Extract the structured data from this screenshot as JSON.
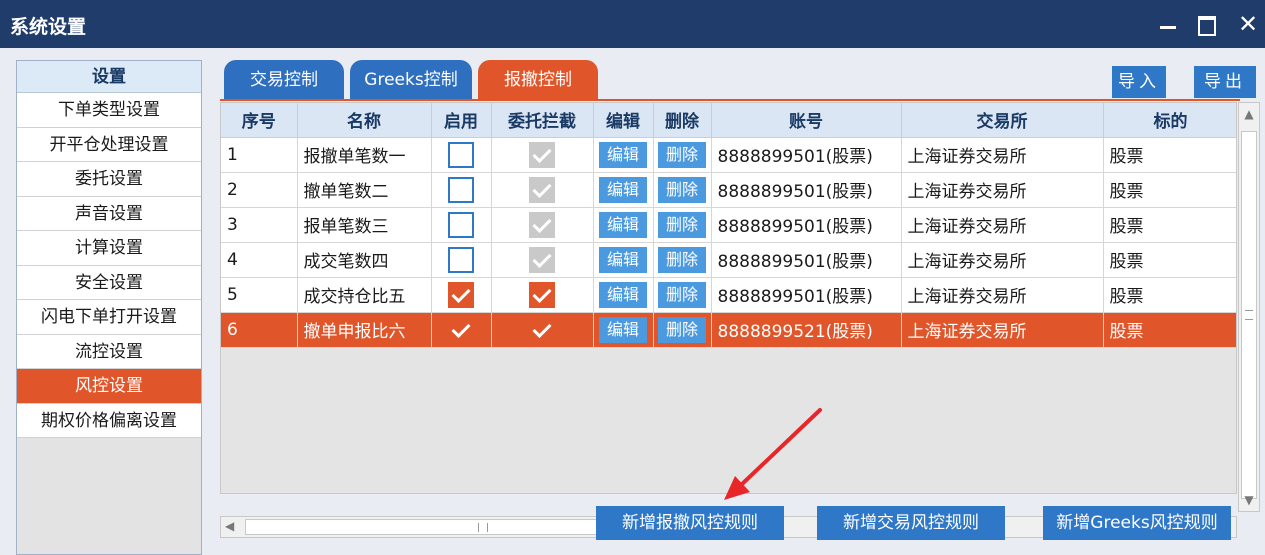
{
  "window": {
    "title": "系统设置"
  },
  "sidebar": {
    "header": "设置",
    "items": [
      "下单类型设置",
      "开平仓处理设置",
      "委托设置",
      "声音设置",
      "计算设置",
      "安全设置",
      "闪电下单打开设置",
      "流控设置",
      "风控设置",
      "期权价格偏离设置"
    ],
    "active_index": 8
  },
  "tabs": [
    "交易控制",
    "Greeks控制",
    "报撤控制"
  ],
  "active_tab": 2,
  "toolbar": {
    "import_label": "导入",
    "export_label": "导出"
  },
  "table": {
    "columns": [
      "序号",
      "名称",
      "启用",
      "委托拦截",
      "编辑",
      "删除",
      "账号",
      "交易所",
      "标的"
    ],
    "edit_label": "编辑",
    "delete_label": "删除",
    "rows": [
      {
        "no": "1",
        "name": "报撤单笔数一",
        "enabled": false,
        "intercept": true,
        "account": "8888899501(股票)",
        "exchange": "上海证券交易所",
        "target": "股票"
      },
      {
        "no": "2",
        "name": "撤单笔数二",
        "enabled": false,
        "intercept": true,
        "account": "8888899501(股票)",
        "exchange": "上海证券交易所",
        "target": "股票"
      },
      {
        "no": "3",
        "name": "报单笔数三",
        "enabled": false,
        "intercept": true,
        "account": "8888899501(股票)",
        "exchange": "上海证券交易所",
        "target": "股票"
      },
      {
        "no": "4",
        "name": "成交笔数四",
        "enabled": false,
        "intercept": true,
        "account": "8888899501(股票)",
        "exchange": "上海证券交易所",
        "target": "股票"
      },
      {
        "no": "5",
        "name": "成交持仓比五",
        "enabled": true,
        "intercept": true,
        "account": "8888899501(股票)",
        "exchange": "上海证券交易所",
        "target": "股票"
      },
      {
        "no": "6",
        "name": "撤单申报比六",
        "enabled": true,
        "intercept": true,
        "account": "8888899521(股票)",
        "exchange": "上海证券交易所",
        "target": "股票"
      }
    ],
    "selected_index": 5
  },
  "actions": [
    "新增报撤风控规则",
    "新增交易风控规则",
    "新增Greeks风控规则"
  ],
  "colors": {
    "titlebar": "#1f3c6b",
    "accent": "#e0552a",
    "blue": "#2f78c8"
  }
}
